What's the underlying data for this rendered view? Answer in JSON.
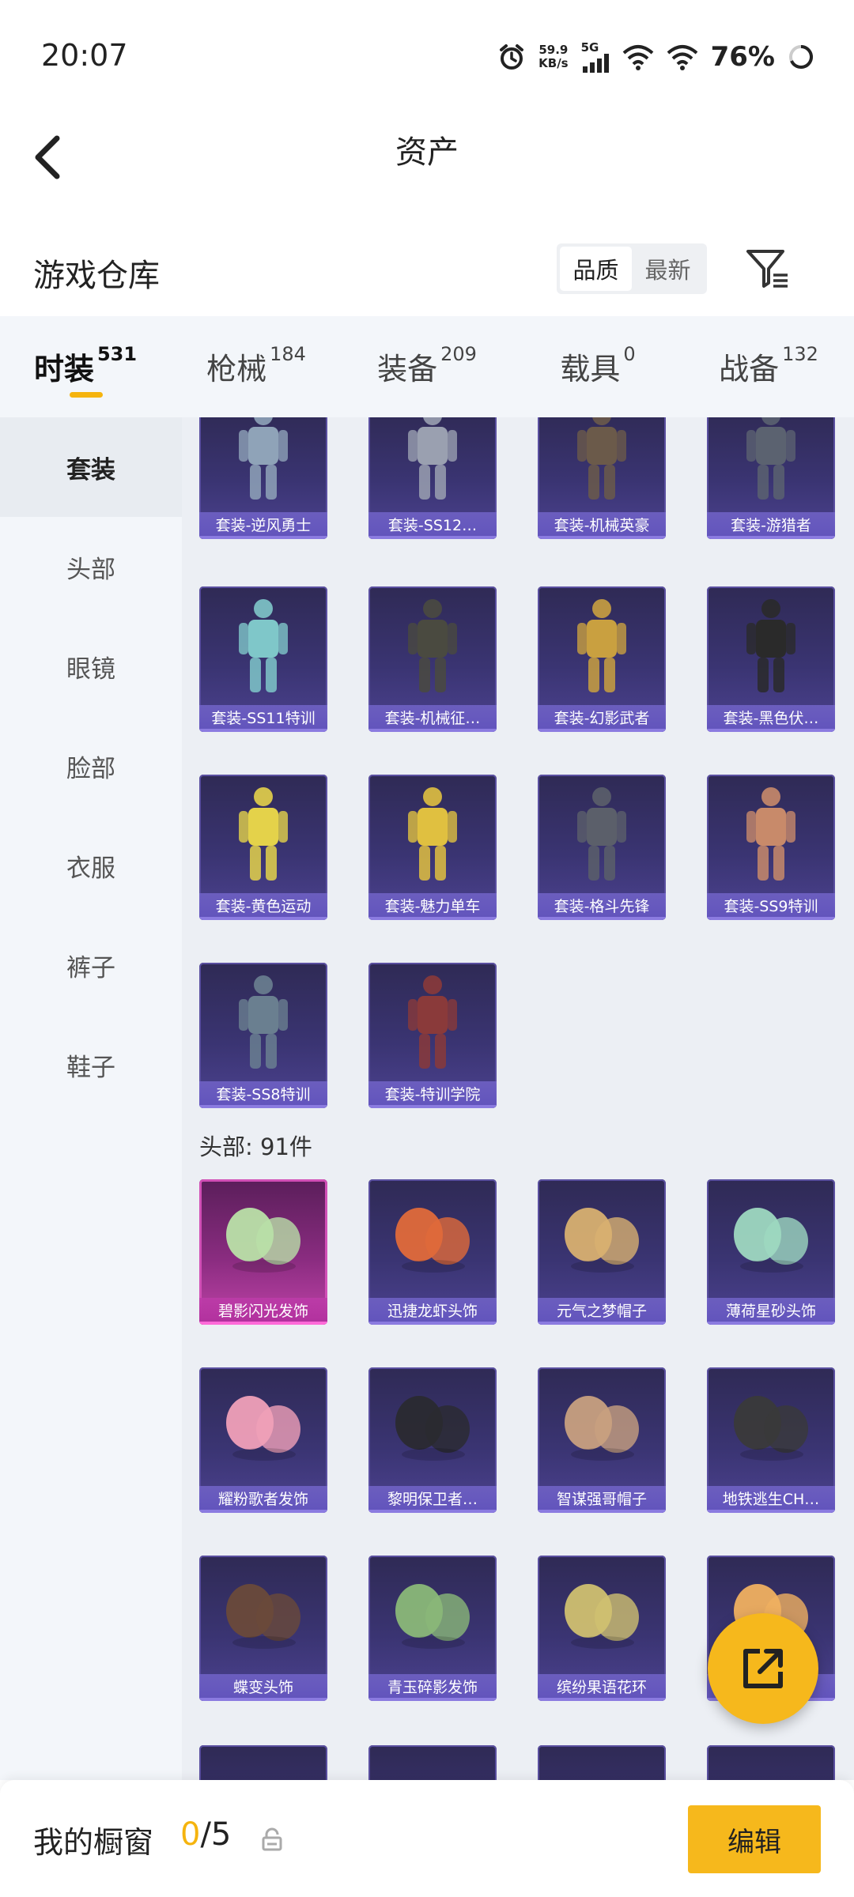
{
  "status_bar": {
    "time": "20:07",
    "net_speed_value": "59.9",
    "net_speed_unit": "KB/s",
    "signal_label": "5G",
    "battery": "76%"
  },
  "header": {
    "title": "资产",
    "back_icon": "chevron-left-icon"
  },
  "warehouse": {
    "title": "游戏仓库",
    "sort_options": [
      "品质",
      "最新"
    ],
    "sort_selected": "品质",
    "filter_icon": "filter-icon"
  },
  "category_tabs": [
    {
      "label": "时装",
      "count": "531",
      "active": true
    },
    {
      "label": "枪械",
      "count": "184",
      "active": false
    },
    {
      "label": "装备",
      "count": "209",
      "active": false
    },
    {
      "label": "载具",
      "count": "0",
      "active": false
    },
    {
      "label": "战备",
      "count": "132",
      "active": false
    }
  ],
  "sidebar": {
    "items": [
      {
        "label": "套装",
        "active": true
      },
      {
        "label": "头部",
        "active": false
      },
      {
        "label": "眼镜",
        "active": false
      },
      {
        "label": "脸部",
        "active": false
      },
      {
        "label": "衣服",
        "active": false
      },
      {
        "label": "裤子",
        "active": false
      },
      {
        "label": "鞋子",
        "active": false
      }
    ]
  },
  "content": {
    "suits": [
      {
        "name": "套装-逆风勇士"
      },
      {
        "name": "套装-SS12…"
      },
      {
        "name": "套装-机械英豪"
      },
      {
        "name": "套装-游猎者"
      },
      {
        "name": "套装-SS11特训"
      },
      {
        "name": "套装-机械征…"
      },
      {
        "name": "套装-幻影武者"
      },
      {
        "name": "套装-黑色伏…"
      },
      {
        "name": "套装-黄色运动"
      },
      {
        "name": "套装-魅力单车"
      },
      {
        "name": "套装-格斗先锋"
      },
      {
        "name": "套装-SS9特训"
      },
      {
        "name": "套装-SS8特训"
      },
      {
        "name": "套装-特训学院"
      }
    ],
    "head_section_label": "头部: 91件",
    "head_items": [
      {
        "name": "碧影闪光发饰",
        "rarity": "pink"
      },
      {
        "name": "迅捷龙虾头饰",
        "rarity": "purple"
      },
      {
        "name": "元气之梦帽子",
        "rarity": "purple"
      },
      {
        "name": "薄荷星砂头饰",
        "rarity": "purple"
      },
      {
        "name": "耀粉歌者发饰",
        "rarity": "purple"
      },
      {
        "name": "黎明保卫者…",
        "rarity": "purple"
      },
      {
        "name": "智谋强哥帽子",
        "rarity": "purple"
      },
      {
        "name": "地铁逃生CH…",
        "rarity": "purple"
      },
      {
        "name": "蝶变头饰",
        "rarity": "purple"
      },
      {
        "name": "青玉碎影发饰",
        "rarity": "purple"
      },
      {
        "name": "缤纷果语花环",
        "rarity": "purple"
      },
      {
        "name": "",
        "rarity": "purple"
      }
    ],
    "colors": {
      "accent": "#f5b40e",
      "card_purple": "#3a3472",
      "card_pink": "#c043a8"
    }
  },
  "fab": {
    "icon": "share-external-icon"
  },
  "bottom_bar": {
    "label": "我的橱窗",
    "current": "0",
    "total": "/5",
    "lock_icon": "lock-icon",
    "edit_label": "编辑"
  }
}
